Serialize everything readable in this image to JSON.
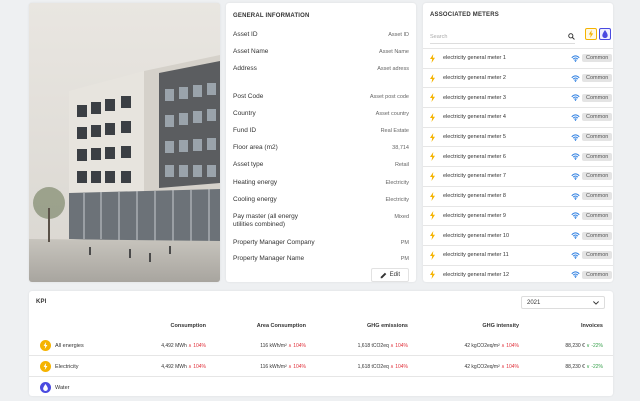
{
  "general": {
    "title": "GENERAL INFORMATION",
    "rows": [
      {
        "label": "Asset ID",
        "value": "Asset ID"
      },
      {
        "label": "Asset Name",
        "value": "Asset Name"
      },
      {
        "label": "Address",
        "value": "Asset adress"
      },
      {
        "label": "Post Code",
        "value": "Asset post code"
      },
      {
        "label": "Country",
        "value": "Asset country"
      },
      {
        "label": "Fund ID",
        "value": "Real Estate"
      },
      {
        "label": "Floor area (m2)",
        "value": "38,714"
      },
      {
        "label": "Asset type",
        "value": "Retail"
      },
      {
        "label": "Heating energy",
        "value": "Electricity"
      },
      {
        "label": "Cooling energy",
        "value": "Electricity"
      },
      {
        "label": "Pay master (all energy utilities combined)",
        "value": "Mixed"
      },
      {
        "label": "Property Manager Company",
        "value": "PM"
      },
      {
        "label": "Property Manager Name",
        "value": "PM"
      }
    ],
    "edit_label": "Edit"
  },
  "meters": {
    "title": "ASSOCIATED METERS",
    "search_placeholder": "Search",
    "badge": "Common",
    "items": [
      "electricity general meter 1",
      "electricity general meter 2",
      "electricity general meter 3",
      "electricity general meter 4",
      "electricity general meter 5",
      "electricity general meter 6",
      "electricity general meter 7",
      "electricity general meter 8",
      "electricity general meter 9",
      "electricity general meter 10",
      "electricity general meter 11",
      "electricity general meter 12"
    ]
  },
  "kpi": {
    "title": "KPI",
    "year": "2021",
    "columns": [
      "Consumption",
      "Area Consumption",
      "GHG emissions",
      "GHG intensity",
      "Invoices"
    ],
    "rows": [
      {
        "label": "All energies",
        "icon": "bolt-icon",
        "consumption": "4,492 MWh",
        "consumption_delta": "104%",
        "area": "116 kWh/m²",
        "area_delta": "104%",
        "ghg": "1,618 tCO2eq",
        "ghg_delta": "104%",
        "intensity": "42 kgCO2eq/m²",
        "intensity_delta": "104%",
        "invoices": "88,230 €",
        "invoices_delta": "-22%"
      },
      {
        "label": "Electricity",
        "icon": "bolt-icon",
        "consumption": "4,492 MWh",
        "consumption_delta": "104%",
        "area": "116 kWh/m²",
        "area_delta": "104%",
        "ghg": "1,618 tCO2eq",
        "ghg_delta": "104%",
        "intensity": "42 kgCO2eq/m²",
        "intensity_delta": "104%",
        "invoices": "88,230 €",
        "invoices_delta": "-22%"
      },
      {
        "label": "Water",
        "icon": "water-drop-icon"
      }
    ]
  },
  "colors": {
    "electricity": "#f5b300",
    "water": "#4a4ae0",
    "wifi": "#2a7de1",
    "up": "#e0303a",
    "down": "#36a04a"
  }
}
